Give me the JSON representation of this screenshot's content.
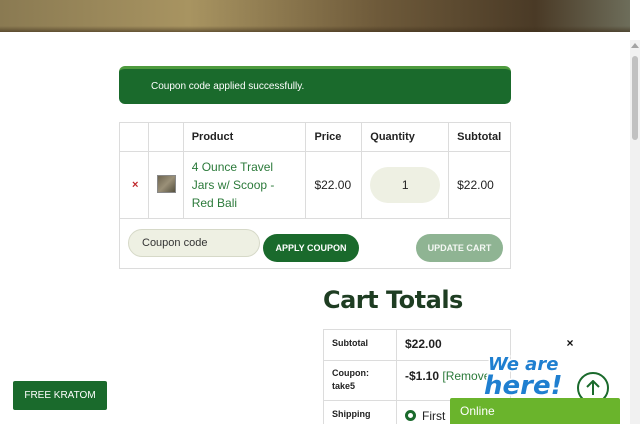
{
  "notice": {
    "text": "Coupon code applied successfully."
  },
  "cart_table": {
    "headers": {
      "remove": "",
      "thumbnail": "",
      "product": "Product",
      "price": "Price",
      "quantity": "Quantity",
      "subtotal": "Subtotal"
    },
    "rows": [
      {
        "remove_glyph": "×",
        "thumbnail_icon": "product-thumbnail-icon",
        "product": "4 Ounce Travel Jars w/ Scoop - Red Bali",
        "price": "$22.00",
        "quantity": "1",
        "subtotal": "$22.00"
      }
    ]
  },
  "actions": {
    "coupon_placeholder": "Coupon code",
    "apply_coupon": "APPLY COUPON",
    "update_cart": "UPDATE CART"
  },
  "totals": {
    "title": "Cart Totals",
    "subtotal_label": "Subtotal",
    "subtotal_value": "$22.00",
    "coupon_label": "Coupon: take5",
    "coupon_value": "-$1.10",
    "coupon_remove": "[Remove",
    "shipping_label": "Shipping",
    "shipping_value": "First"
  },
  "floating": {
    "free_kratom": "FREE KRATOM",
    "chat_close": "×",
    "chat_badge": "We are here!",
    "chat_status": "Online"
  },
  "colors": {
    "brand_green": "#1a6a2c",
    "accent_green": "#6ab42c",
    "remove_red": "#c0282c",
    "input_bg": "#eef0e3"
  }
}
